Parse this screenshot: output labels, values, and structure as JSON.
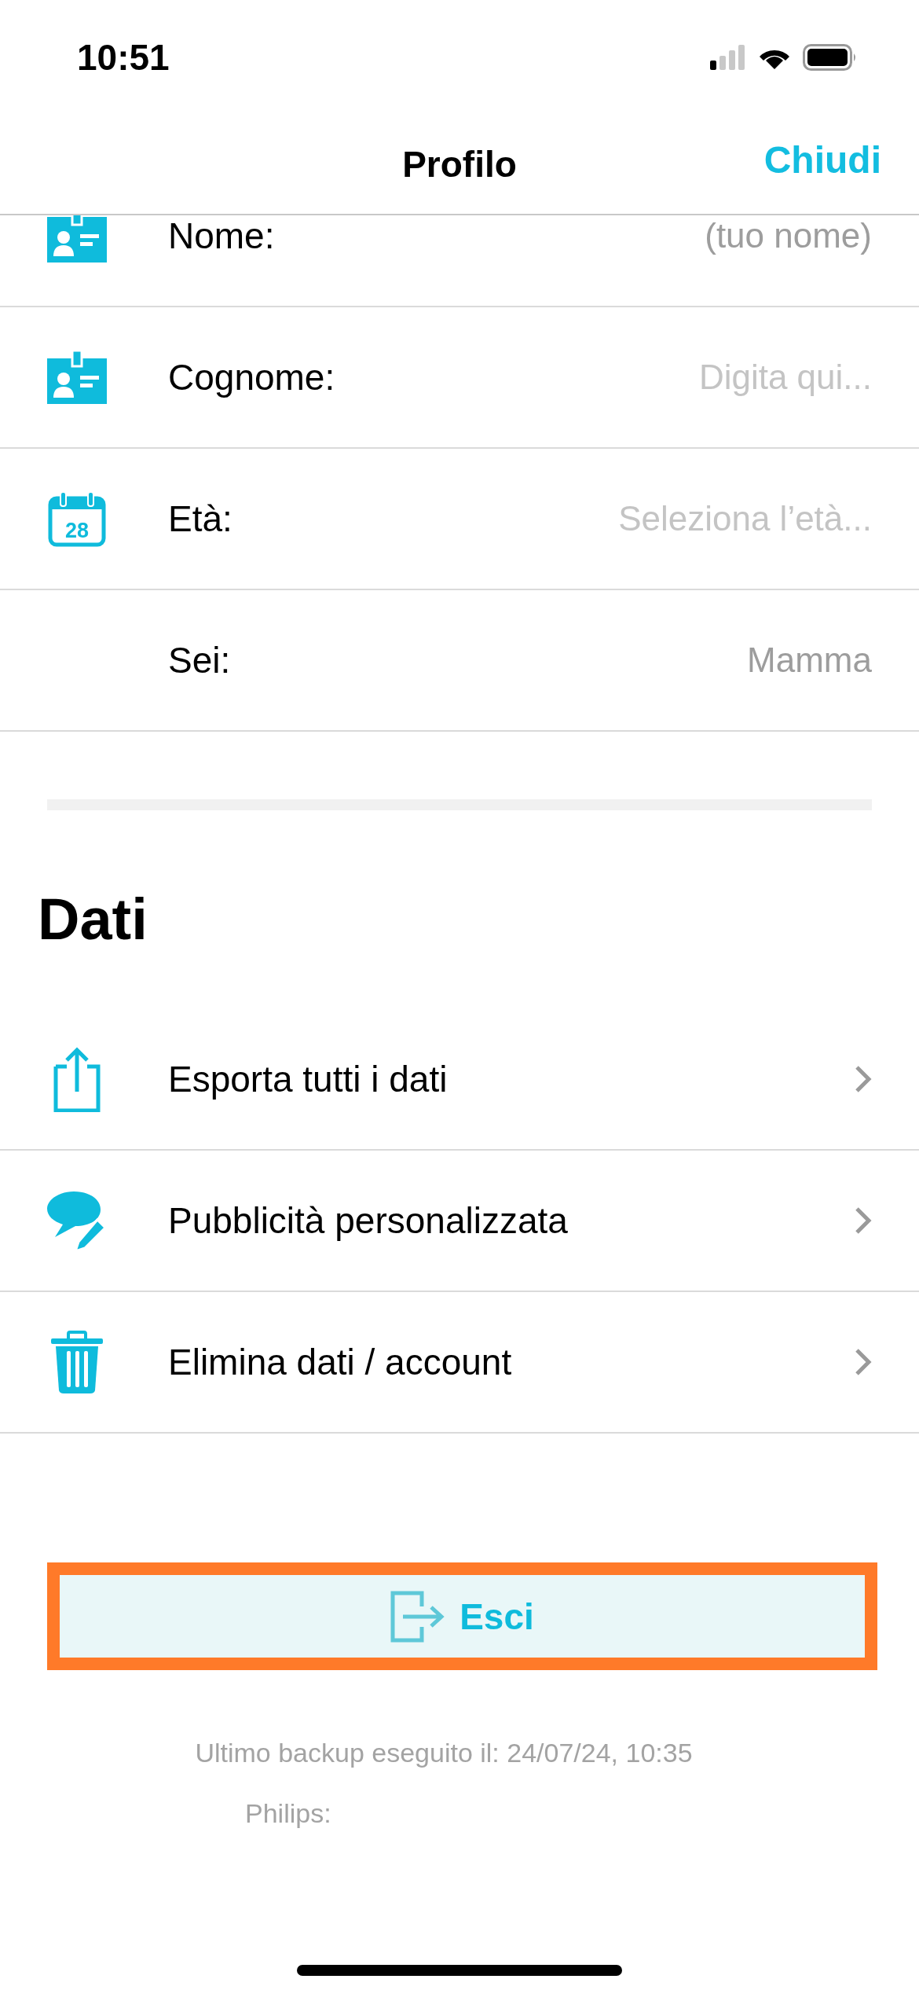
{
  "status_bar": {
    "time": "10:51"
  },
  "nav": {
    "title": "Profilo",
    "action": "Chiudi"
  },
  "profile_fields": [
    {
      "kind": "card",
      "label": "Nome:",
      "value": "(tuo nome)"
    },
    {
      "kind": "card",
      "label": "Cognome:",
      "placeholder": "Digita qui..."
    },
    {
      "kind": "calendar",
      "icon_text": "28",
      "label": "Età:",
      "placeholder": "Seleziona l’età..."
    },
    {
      "kind": "plain",
      "label": "Sei:",
      "value": "Mamma"
    }
  ],
  "data_section": {
    "title": "Dati",
    "items": [
      {
        "kind": "export",
        "label": "Esporta tutti i dati"
      },
      {
        "kind": "ads",
        "label": "Pubblicità personalizzata"
      },
      {
        "kind": "delete",
        "label": "Elimina dati / account"
      }
    ]
  },
  "logout_button": {
    "label": "Esci",
    "highlighted": true
  },
  "footer": {
    "backup": "Ultimo backup eseguito il: 24/07/24, 10:35",
    "device": "Philips:"
  }
}
